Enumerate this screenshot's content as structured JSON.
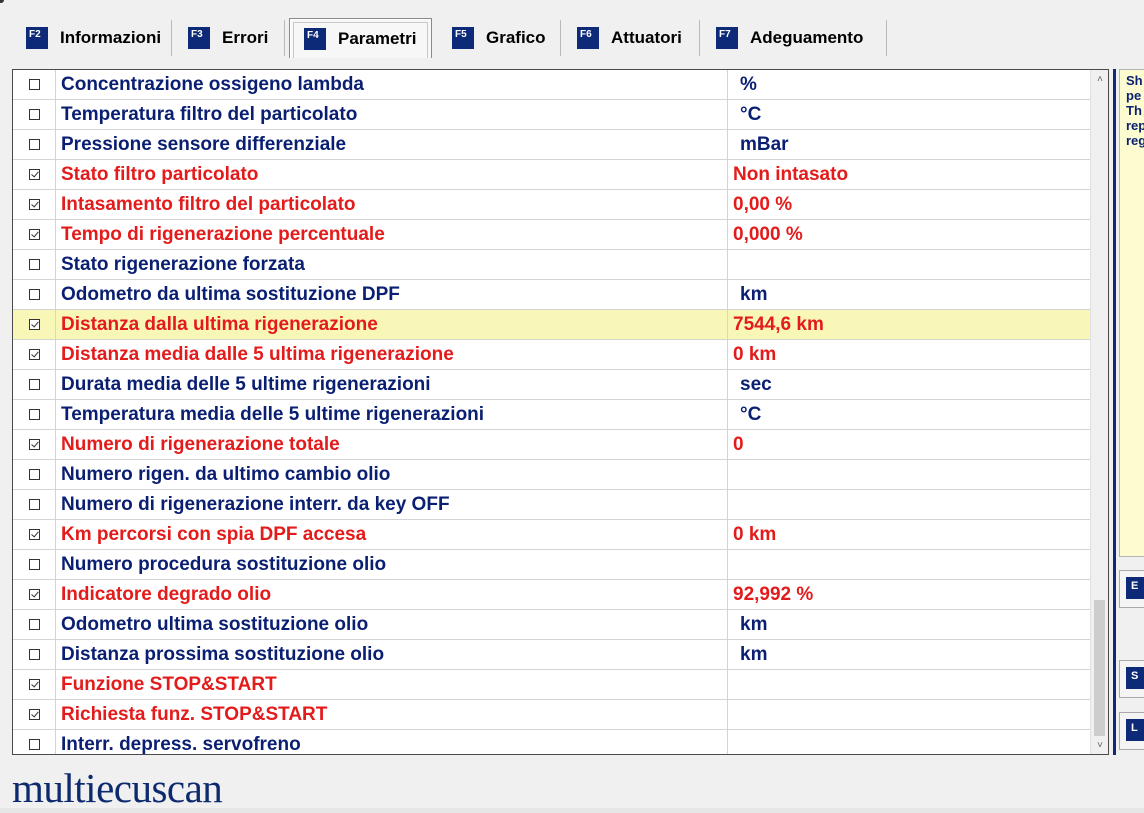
{
  "tabs": [
    {
      "key": "F2",
      "label": "Informazioni",
      "active": false
    },
    {
      "key": "F3",
      "label": "Errori",
      "active": false
    },
    {
      "key": "F4",
      "label": "Parametri",
      "active": true
    },
    {
      "key": "F5",
      "label": "Grafico",
      "active": false
    },
    {
      "key": "F6",
      "label": "Attuatori",
      "active": false
    },
    {
      "key": "F7",
      "label": "Adeguamento",
      "active": false
    }
  ],
  "parameters": [
    {
      "name": "Concentrazione ossigeno lambda",
      "value": "%",
      "checked": false,
      "unit_only": true
    },
    {
      "name": "Temperatura filtro del particolato",
      "value": "°C",
      "checked": false,
      "unit_only": true
    },
    {
      "name": "Pressione sensore differenziale",
      "value": "mBar",
      "checked": false,
      "unit_only": true
    },
    {
      "name": "Stato filtro particolato",
      "value": "Non intasato",
      "checked": true
    },
    {
      "name": "Intasamento filtro del particolato",
      "value": "0,00 %",
      "checked": true
    },
    {
      "name": "Tempo di rigenerazione percentuale",
      "value": "0,000 %",
      "checked": true
    },
    {
      "name": "Stato rigenerazione forzata",
      "value": "",
      "checked": false
    },
    {
      "name": "Odometro da ultima sostituzione DPF",
      "value": "km",
      "checked": false,
      "unit_only": true
    },
    {
      "name": "Distanza dalla ultima rigenerazione",
      "value": "7544,6 km",
      "checked": true,
      "highlight": true
    },
    {
      "name": "Distanza media dalle 5 ultima rigenerazione",
      "value": "0 km",
      "checked": true
    },
    {
      "name": "Durata media delle 5 ultime rigenerazioni",
      "value": "sec",
      "checked": false,
      "unit_only": true
    },
    {
      "name": "Temperatura media delle 5 ultime rigenerazioni",
      "value": "°C",
      "checked": false,
      "unit_only": true
    },
    {
      "name": "Numero di rigenerazione totale",
      "value": "0",
      "checked": true
    },
    {
      "name": "Numero rigen. da ultimo cambio olio",
      "value": "",
      "checked": false
    },
    {
      "name": "Numero di rigenerazione interr. da key OFF",
      "value": "",
      "checked": false
    },
    {
      "name": "Km percorsi con spia DPF accesa",
      "value": "0 km",
      "checked": true
    },
    {
      "name": "Numero procedura sostituzione olio",
      "value": "",
      "checked": false
    },
    {
      "name": "Indicatore degrado olio",
      "value": "92,992 %",
      "checked": true
    },
    {
      "name": "Odometro ultima sostituzione olio",
      "value": "km",
      "checked": false,
      "unit_only": true
    },
    {
      "name": "Distanza prossima sostituzione olio",
      "value": "km",
      "checked": false,
      "unit_only": true
    },
    {
      "name": "Funzione STOP&START",
      "value": "",
      "checked": true
    },
    {
      "name": "Richiesta funz. STOP&START",
      "value": "",
      "checked": true
    },
    {
      "name": "Interr. depress. servofreno",
      "value": "",
      "checked": false
    }
  ],
  "info_panel_lines": [
    "Sh",
    "pe",
    "Th",
    "rep",
    "reg"
  ],
  "side_buttons": [
    {
      "key": "E"
    },
    {
      "key": "S"
    },
    {
      "key": "L"
    }
  ],
  "logo": "multiecuscan",
  "colors": {
    "checked_text": "#e31b1b",
    "unchecked_text": "#0a1f72",
    "highlight_row": "#f9f7b8",
    "fkey_bg": "#0d2a78"
  }
}
